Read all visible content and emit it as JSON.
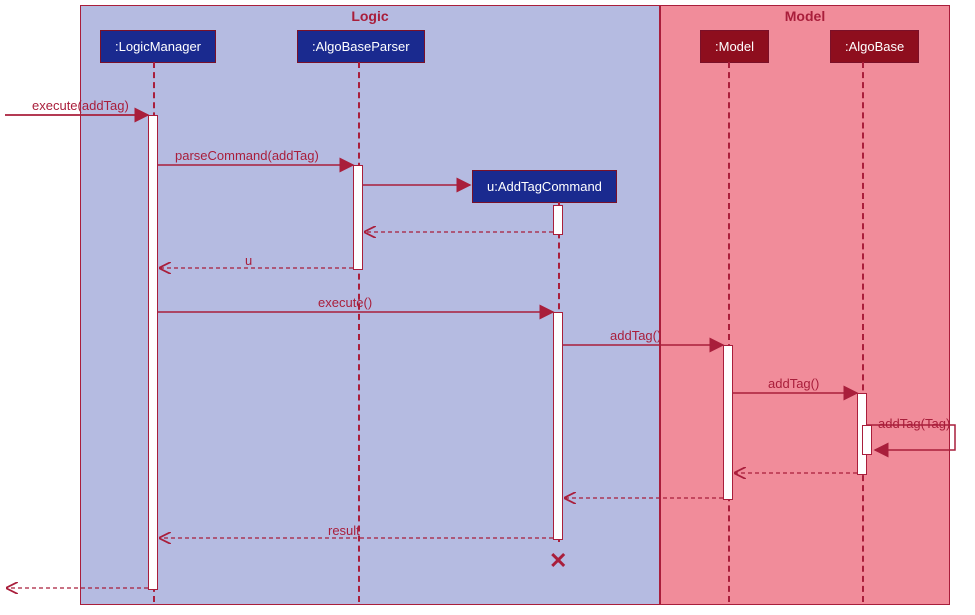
{
  "frames": {
    "logic": {
      "title": "Logic"
    },
    "model": {
      "title": "Model"
    }
  },
  "participants": {
    "logicManager": ":LogicManager",
    "algoBaseParser": ":AlgoBaseParser",
    "addTagCommand": "u:AddTagCommand",
    "model": ":Model",
    "algoBase": ":AlgoBase"
  },
  "messages": {
    "execute1": "execute(addTag)",
    "parseCommand": "parseCommand(addTag)",
    "returnU": "u",
    "execute2": "execute()",
    "addTag1": "addTag()",
    "addTag2": "addTag()",
    "addTag3": "addTag(Tag)",
    "result": "result"
  },
  "chart_data": {
    "type": "sequence-diagram",
    "title": "",
    "frames": [
      {
        "name": "Logic",
        "participants": [
          "LogicManager",
          "AlgoBaseParser",
          "AddTagCommand"
        ]
      },
      {
        "name": "Model",
        "participants": [
          "Model",
          "AlgoBase"
        ]
      }
    ],
    "participants": [
      {
        "id": "LogicManager",
        "label": ":LogicManager",
        "frame": "Logic"
      },
      {
        "id": "AlgoBaseParser",
        "label": ":AlgoBaseParser",
        "frame": "Logic"
      },
      {
        "id": "AddTagCommand",
        "label": "u:AddTagCommand",
        "frame": "Logic",
        "created_dynamically": true
      },
      {
        "id": "Model",
        "label": ":Model",
        "frame": "Model"
      },
      {
        "id": "AlgoBase",
        "label": ":AlgoBase",
        "frame": "Model"
      }
    ],
    "messages": [
      {
        "from": "external",
        "to": "LogicManager",
        "label": "execute(addTag)",
        "type": "call"
      },
      {
        "from": "LogicManager",
        "to": "AlgoBaseParser",
        "label": "parseCommand(addTag)",
        "type": "call"
      },
      {
        "from": "AlgoBaseParser",
        "to": "AddTagCommand",
        "label": "",
        "type": "create"
      },
      {
        "from": "AddTagCommand",
        "to": "AlgoBaseParser",
        "label": "",
        "type": "return"
      },
      {
        "from": "AlgoBaseParser",
        "to": "LogicManager",
        "label": "u",
        "type": "return"
      },
      {
        "from": "LogicManager",
        "to": "AddTagCommand",
        "label": "execute()",
        "type": "call"
      },
      {
        "from": "AddTagCommand",
        "to": "Model",
        "label": "addTag()",
        "type": "call"
      },
      {
        "from": "Model",
        "to": "AlgoBase",
        "label": "addTag()",
        "type": "call"
      },
      {
        "from": "AlgoBase",
        "to": "AlgoBase",
        "label": "addTag(Tag)",
        "type": "self-call"
      },
      {
        "from": "AlgoBase",
        "to": "Model",
        "label": "",
        "type": "return"
      },
      {
        "from": "Model",
        "to": "AddTagCommand",
        "label": "",
        "type": "return"
      },
      {
        "from": "AddTagCommand",
        "to": "LogicManager",
        "label": "result",
        "type": "return"
      },
      {
        "from": "AddTagCommand",
        "to": "",
        "label": "",
        "type": "destroy"
      },
      {
        "from": "LogicManager",
        "to": "external",
        "label": "",
        "type": "return"
      }
    ]
  }
}
